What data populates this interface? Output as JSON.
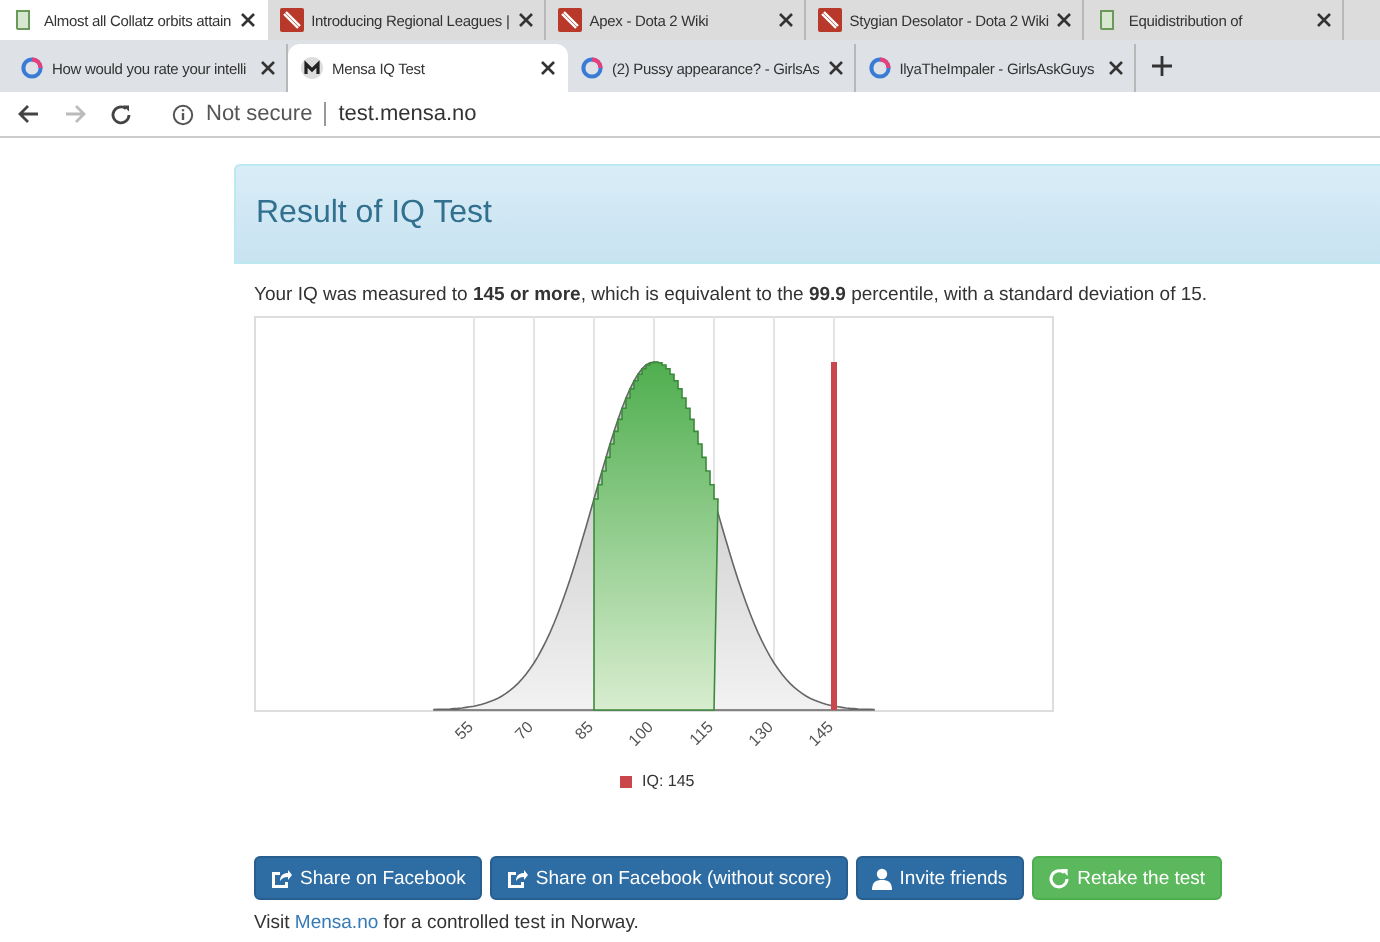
{
  "back_window_tabs": [
    {
      "title": "Almost all Collatz orbits attain",
      "kind": "book",
      "selected": true
    },
    {
      "title": "Introducing Regional Leagues |",
      "kind": "game",
      "selected": false
    },
    {
      "title": "Apex - Dota 2 Wiki",
      "kind": "game",
      "selected": false
    },
    {
      "title": "Stygian Desolator - Dota 2 Wiki",
      "kind": "game",
      "selected": false
    },
    {
      "title": "Equidistribution of",
      "kind": "book",
      "selected": false
    }
  ],
  "tabs": [
    {
      "title": "How would you rate your intelli",
      "kind": "ring",
      "selected": false
    },
    {
      "title": "Mensa IQ Test",
      "kind": "emblem",
      "selected": true
    },
    {
      "title": "(2) Pussy appearance? - GirlsAs",
      "kind": "ring",
      "selected": false
    },
    {
      "title": "IlyaTheImpaler - GirlsAskGuys",
      "kind": "ring",
      "selected": false
    }
  ],
  "address_bar": {
    "security": "Not secure",
    "url": "test.mensa.no",
    "forward_disabled": true
  },
  "panel": {
    "title": "Result of IQ Test",
    "summary": "Your IQ was measured to **145 or more**, which is equivalent to the **99.9** percentile, with a standard deviation of 15.",
    "chart": {
      "x_ticks": [
        "55",
        "70",
        "85",
        "100",
        "115",
        "130",
        "145"
      ],
      "legend": "IQ: 145"
    },
    "buttons": [
      {
        "label": "Share on Facebook",
        "kind": "share"
      },
      {
        "label": "Share on Facebook (without score)",
        "kind": "share"
      },
      {
        "label": "Invite friends",
        "kind": "invite"
      },
      {
        "label": "Retake the test",
        "kind": "retake"
      }
    ],
    "footer": {
      "before": "Visit",
      "link": "Mensa.no",
      "after": "for a controlled test in Norway."
    }
  }
}
